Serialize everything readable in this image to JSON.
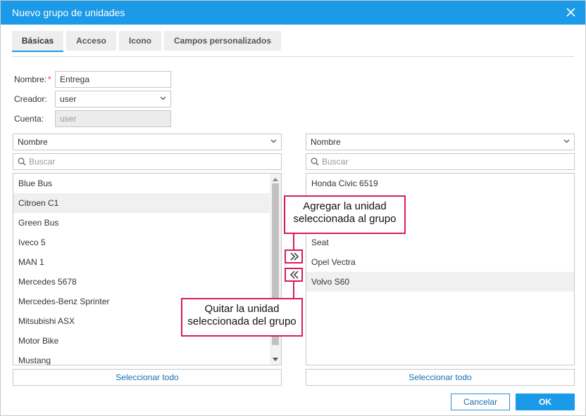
{
  "dialog": {
    "title": "Nuevo grupo de unidades"
  },
  "tabs": [
    {
      "label": "Básicas"
    },
    {
      "label": "Acceso"
    },
    {
      "label": "Icono"
    },
    {
      "label": "Campos personalizados"
    }
  ],
  "form": {
    "name_label": "Nombre:",
    "name_required": "*",
    "name_value": "Entrega",
    "creator_label": "Creador:",
    "creator_value": "user",
    "account_label": "Cuenta:",
    "account_value": "user"
  },
  "left_panel": {
    "sort_value": "Nombre",
    "search_placeholder": "Buscar",
    "items": [
      "Blue Bus",
      "Citroen C1",
      "Green Bus",
      "Iveco 5",
      "MAN 1",
      "Mercedes 5678",
      "Mercedes-Benz Sprinter",
      "Mitsubishi ASX",
      "Motor Bike",
      "Mustang"
    ],
    "select_all": "Seleccionar todo"
  },
  "right_panel": {
    "sort_value": "Nombre",
    "search_placeholder": "Buscar",
    "items": [
      "Honda Civic 6519",
      "Seat",
      "Opel Vectra",
      "Volvo S60"
    ],
    "select_all": "Seleccionar todo"
  },
  "callouts": {
    "add_line1": "Agregar la unidad",
    "add_line2": "seleccionada al grupo",
    "remove_line1": "Quitar la unidad",
    "remove_line2": "seleccionada del grupo"
  },
  "footer": {
    "cancel": "Cancelar",
    "ok": "OK"
  },
  "colors": {
    "accent": "#1b9ae8",
    "highlight": "#d81b60"
  },
  "icons": {
    "close": "close-icon",
    "chevron": "chevron-down-icon",
    "search": "search-icon",
    "add": "double-chevron-right-icon",
    "remove": "double-chevron-left-icon"
  }
}
